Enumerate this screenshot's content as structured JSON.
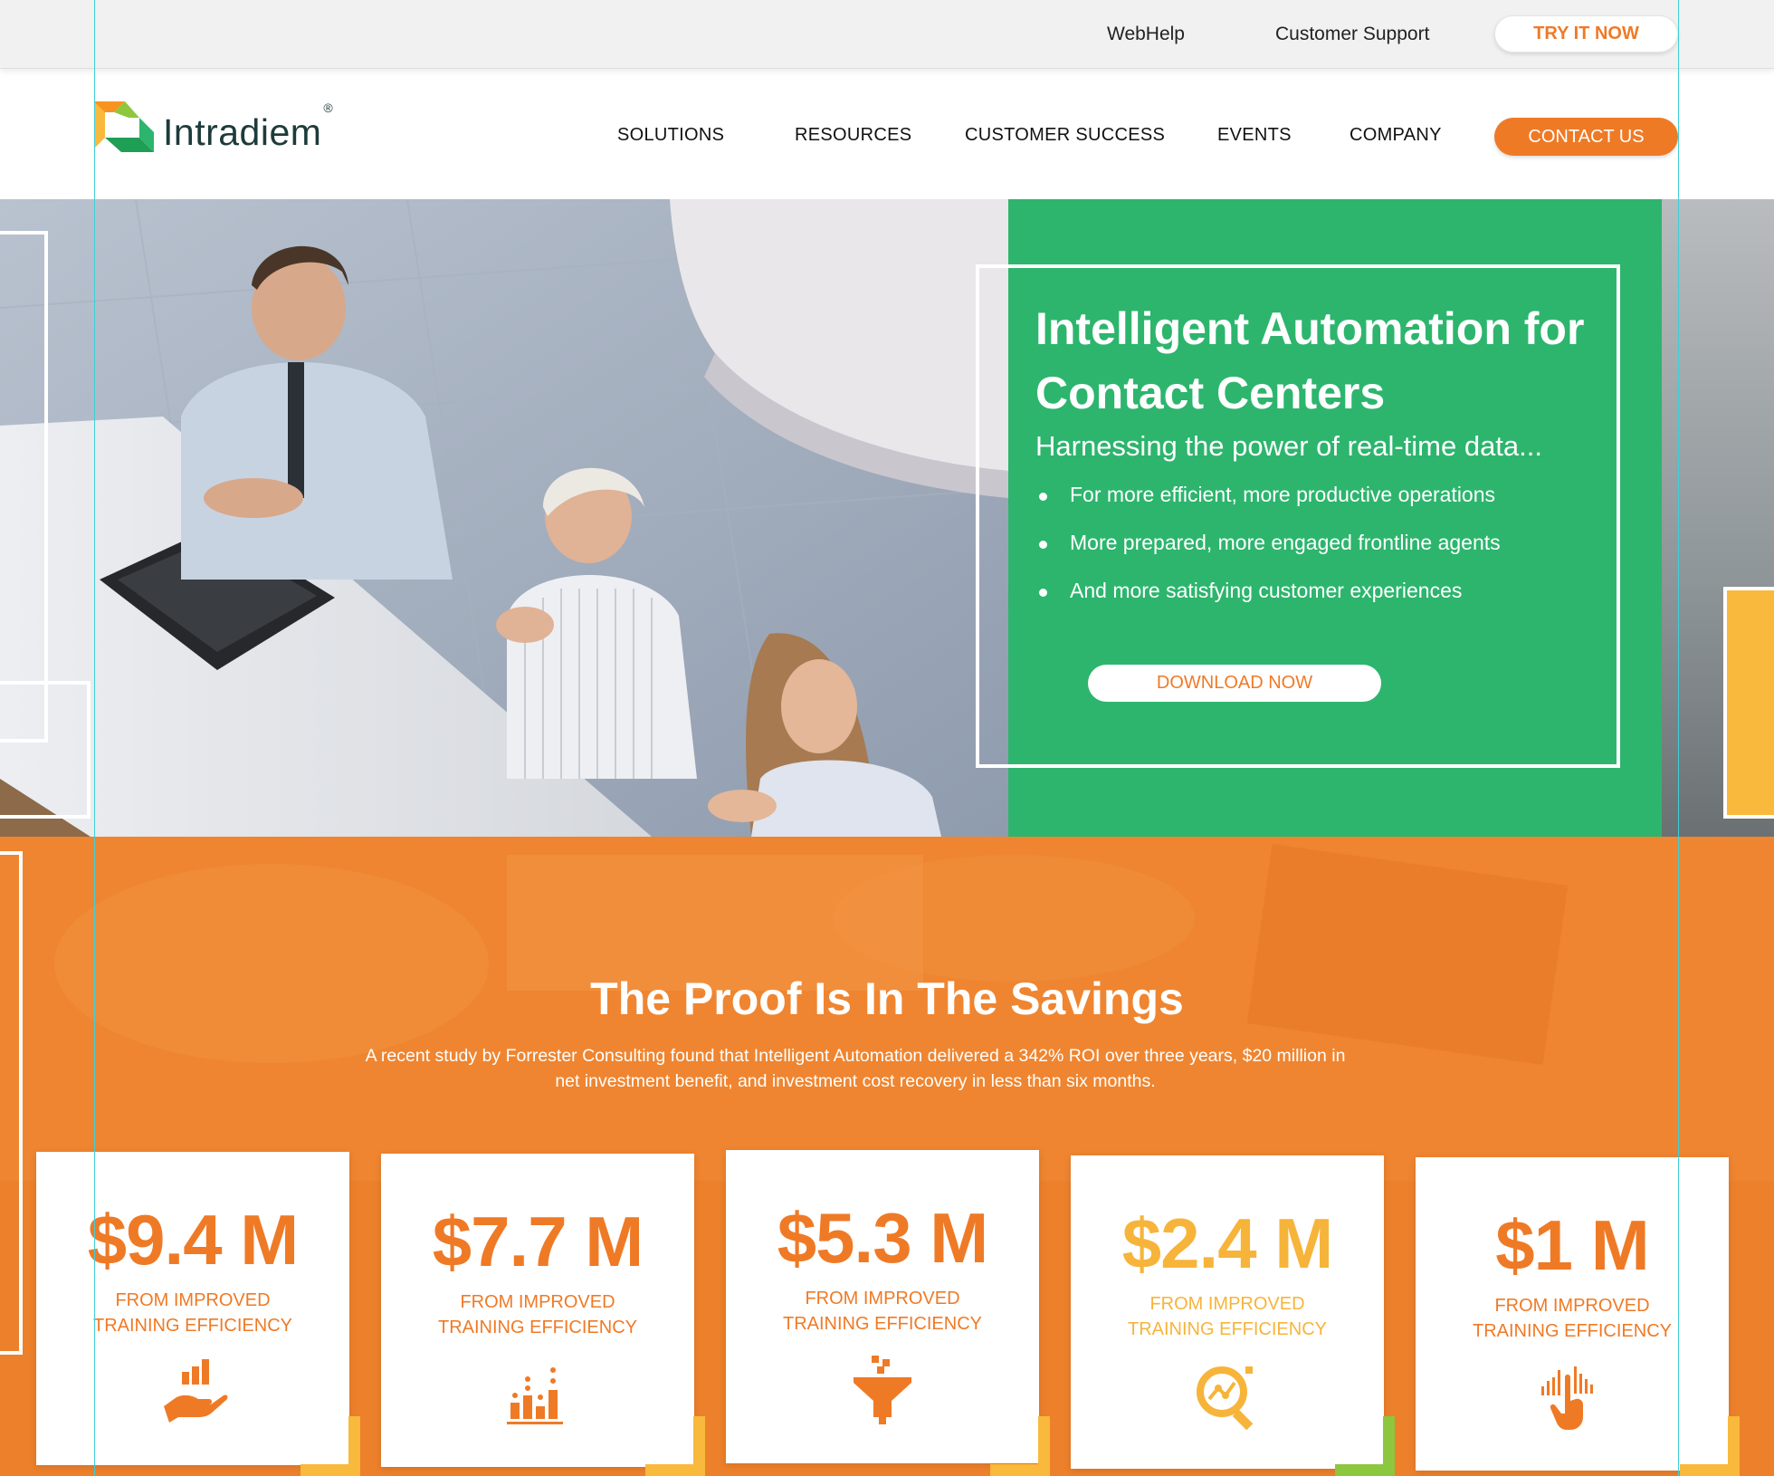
{
  "utility_bar": {
    "webhelp": "WebHelp",
    "customer_support": "Customer Support",
    "try_it_now": "TRY IT NOW"
  },
  "nav": {
    "logo_text": "Intradiem",
    "logo_reg": "®",
    "items": [
      {
        "label": "SOLUTIONS"
      },
      {
        "label": "RESOURCES"
      },
      {
        "label": "CUSTOMER SUCCESS"
      },
      {
        "label": "EVENTS"
      },
      {
        "label": "COMPANY"
      }
    ],
    "contact_us": "CONTACT US"
  },
  "hero": {
    "title": "Intelligent Automation for Contact Centers",
    "subtitle": "Harnessing the power of real-time data...",
    "bullets": [
      "For more efficient, more productive operations",
      "More prepared, more engaged frontline agents",
      "And more satisfying customer experiences"
    ],
    "cta": "DOWNLOAD NOW"
  },
  "savings": {
    "title": "The Proof Is In The Savings",
    "description": "A recent study by Forrester Consulting found that Intelligent Automation delivered a 342% ROI over three years, $20 million in net investment benefit, and investment cost recovery in less than six months.",
    "cards": [
      {
        "value": "$9.4 M",
        "label_line1": "FROM IMPROVED",
        "label_line2": "TRAINING EFFICIENCY",
        "icon": "hand-chart-icon"
      },
      {
        "value": "$7.7 M",
        "label_line1": "FROM IMPROVED",
        "label_line2": "TRAINING EFFICIENCY",
        "icon": "bar-chart-icon"
      },
      {
        "value": "$5.3 M",
        "label_line1": "FROM IMPROVED",
        "label_line2": "TRAINING EFFICIENCY",
        "icon": "funnel-icon"
      },
      {
        "value": "$2.4 M",
        "label_line1": "FROM IMPROVED",
        "label_line2": "TRAINING EFFICIENCY",
        "icon": "magnifier-analytics-icon"
      },
      {
        "value": "$1 M",
        "label_line1": "FROM IMPROVED",
        "label_line2": "TRAINING EFFICIENCY",
        "icon": "touch-signal-icon"
      }
    ]
  },
  "colors": {
    "brand_orange": "#ef7a26",
    "brand_green": "#2db56d",
    "accent_gold": "#f9b93c",
    "accent_lime": "#8dc63f"
  }
}
